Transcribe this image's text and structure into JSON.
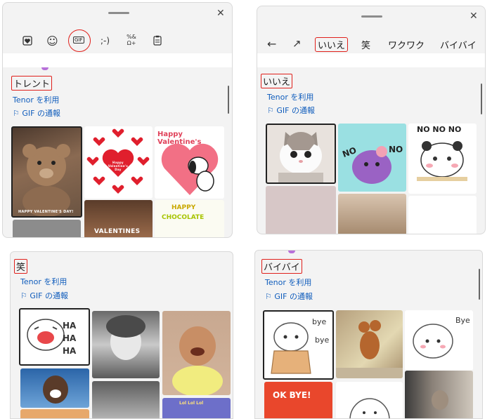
{
  "panel1": {
    "toolbar": {
      "stickers_icon": "sticker-heart-icon",
      "emoji_icon": "smiley-icon",
      "gif_label": "GIF",
      "kaomoji_label": ";-)",
      "symbols_label": "%&\n Ω+",
      "clipboard_icon": "clipboard-icon"
    },
    "section_title": "トレント",
    "tenor_link": "Tenor を利用",
    "report_link": "GIF の通報",
    "gif_captions": {
      "bear": "HAPPY VALENTINE'S DAY!",
      "snoopy": "Happy Valentine's",
      "valentines": "VALENTINES",
      "happy": "HAPPY",
      "chocolate": "CHOCOLATE",
      "heart_center": "Happy Valentine's Day"
    }
  },
  "panel2": {
    "back_icon": "arrow-left-icon",
    "trending_icon": "trending-arrow-icon",
    "tabs": [
      "いいえ",
      "笑",
      "ワクワク",
      "バイバイ"
    ],
    "section_title": "いいえ",
    "tenor_link": "Tenor を利用",
    "report_link": "GIF の通報",
    "gif_captions": {
      "nono": "NO NO NO",
      "no_left": "NO",
      "no_right": "NO"
    }
  },
  "panel3": {
    "section_title": "笑",
    "tenor_link": "Tenor を利用",
    "report_link": "GIF の通報",
    "gif_captions": {
      "haha": "HA HA HA",
      "lol": "Lol Lol Lol"
    }
  },
  "panel4": {
    "section_title": "バイバイ",
    "tenor_link": "Tenor を利用",
    "report_link": "GIF の通報",
    "gif_captions": {
      "bye1": "bye",
      "bye2": "bye",
      "bye3": "Bye",
      "okbye": "OK BYE!"
    }
  },
  "colors": {
    "highlight": "#e0201b",
    "link": "#0f5cbc",
    "panel_bg": "#f3f3f3"
  }
}
